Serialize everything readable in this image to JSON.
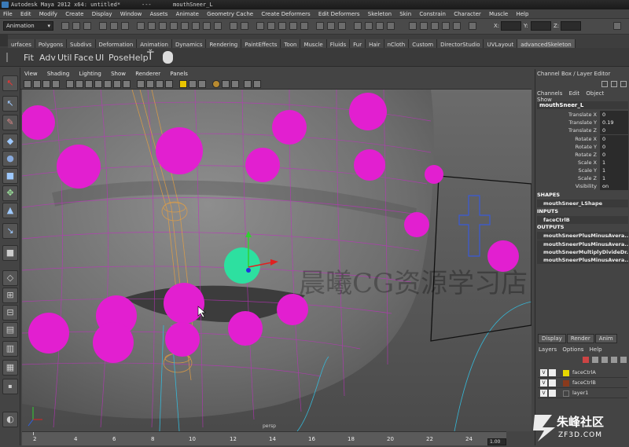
{
  "window": {
    "title": "Autodesk Maya 2012 x64: untitled*",
    "separator": "---",
    "object": "mouthSneer_L"
  },
  "menu": [
    "File",
    "Edit",
    "Modify",
    "Create",
    "Display",
    "Window",
    "Assets",
    "Animate",
    "Geometry Cache",
    "Create Deformers",
    "Edit Deformers",
    "Skeleton",
    "Skin",
    "Constrain",
    "Character",
    "Muscle",
    "Help"
  ],
  "status_line": {
    "mode": "Animation",
    "x_label": "X:",
    "y_label": "Y:",
    "z_label": "Z:"
  },
  "shelf_tabs": [
    "urfaces",
    "Polygons",
    "Subdivs",
    "Deformation",
    "Animation",
    "Dynamics",
    "Rendering",
    "PaintEffects",
    "Toon",
    "Muscle",
    "Fluids",
    "Fur",
    "Hair",
    "nCloth",
    "Custom",
    "DirectorStudio",
    "UVLayout",
    "advancedSkeleton"
  ],
  "shelf_buttons": [
    "Fit",
    "Adv",
    "Util",
    "Face",
    "UI",
    "PoseHelp"
  ],
  "panel_menu": [
    "View",
    "Shading",
    "Lighting",
    "Show",
    "Renderer",
    "Panels"
  ],
  "channel_box": {
    "title": "Channel Box / Layer Editor",
    "menu": [
      "Channels",
      "Edit",
      "Object",
      "Show"
    ],
    "object_name": "mouthSneer_L",
    "attributes": [
      {
        "label": "Translate X",
        "value": "0"
      },
      {
        "label": "Translate Y",
        "value": "0.19"
      },
      {
        "label": "Translate Z",
        "value": "0"
      },
      {
        "label": "Rotate X",
        "value": "0"
      },
      {
        "label": "Rotate Y",
        "value": "0"
      },
      {
        "label": "Rotate Z",
        "value": "0"
      },
      {
        "label": "Scale X",
        "value": "1"
      },
      {
        "label": "Scale Y",
        "value": "1"
      },
      {
        "label": "Scale Z",
        "value": "1"
      },
      {
        "label": "Visibility",
        "value": "on"
      }
    ],
    "shapes_header": "SHAPES",
    "shape_node": "mouthSneer_LShape",
    "inputs_header": "INPUTS",
    "input_node": "faceCtrlB",
    "outputs_header": "OUTPUTS",
    "output_nodes": [
      "mouthSneerPlusMinusAvera...",
      "mouthSneerPlusMinusAvera...",
      "mouthSneerMultiplyDivideDr...",
      "mouthSneerPlusMinusAvera..."
    ]
  },
  "layer_editor": {
    "tabs": [
      "Display",
      "Render",
      "Anim"
    ],
    "menu": [
      "Layers",
      "Options",
      "Help"
    ],
    "layers": [
      {
        "name": "faceCtrlA",
        "visible": "V",
        "color": "#e6d800"
      },
      {
        "name": "faceCtrlB",
        "visible": "V",
        "color": "#8a3a1c"
      },
      {
        "name": "layer1",
        "visible": "V",
        "color": "#444444"
      }
    ]
  },
  "timeline": {
    "ticks": [
      "2",
      "4",
      "6",
      "8",
      "10",
      "12",
      "14",
      "16",
      "18",
      "20",
      "22",
      "24"
    ],
    "current": "1.00"
  },
  "viewport_overlay": {
    "watermark": "晨曦CG资源学习店",
    "corner_logo": "朱峰社区",
    "corner_url": "ZF3D.COM",
    "hud_text": "persp"
  },
  "colors": {
    "control_magenta": "#e21fd0",
    "selected_control": "#2de0a0",
    "wire_magenta": "#c030c0",
    "blue_curve": "#3a5ad8",
    "cyan_curve": "#35b8d8"
  }
}
